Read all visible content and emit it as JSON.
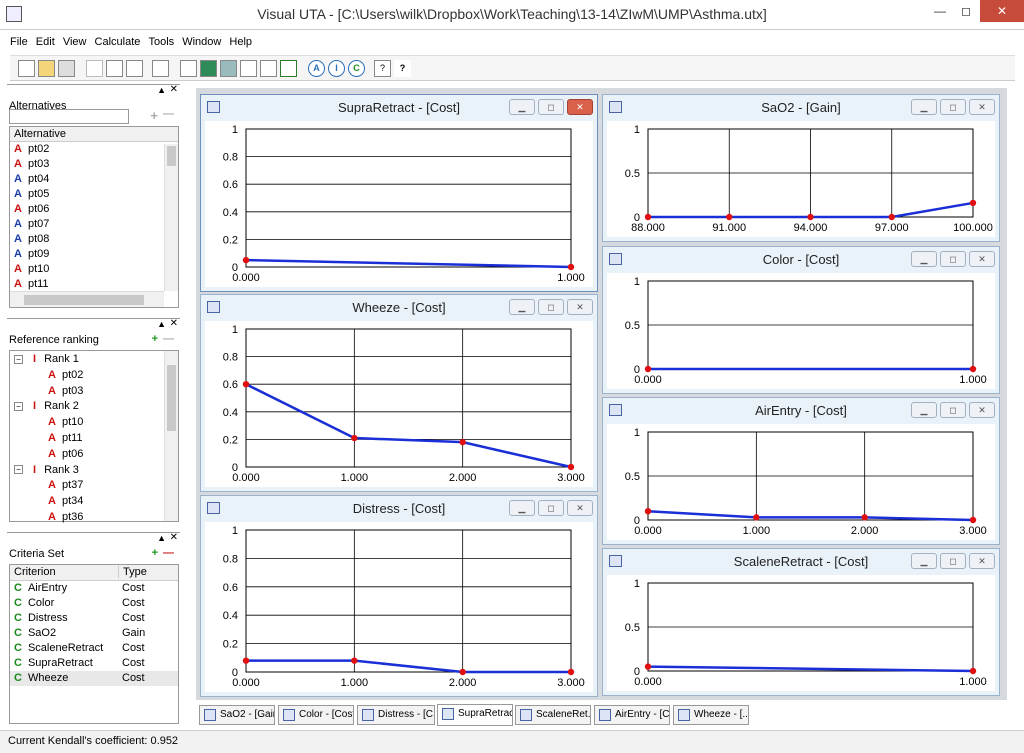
{
  "window": {
    "title": "Visual UTA - [C:\\Users\\wilk\\Dropbox\\Work\\Teaching\\13-14\\ZIwM\\UMP\\Asthma.utx]",
    "minimize": "—",
    "maximize": "◻",
    "close": "✕"
  },
  "menu": [
    "File",
    "Edit",
    "View",
    "Calculate",
    "Tools",
    "Window",
    "Help"
  ],
  "toolbar": [
    "new-icon",
    "open-icon",
    "save-icon",
    "cut-icon",
    "copy-icon",
    "paste-icon",
    "print-icon",
    "calculator-icon",
    "grid-icon",
    "table-icon",
    "chart-icon",
    "report-icon",
    "bar-chart-icon",
    "alternatives-icon",
    "info-icon",
    "criteria-icon",
    "help-icon",
    "context-help-icon"
  ],
  "toolbar_glyphs": {
    "alt": "A",
    "info": "I",
    "crit": "C",
    "help": "?",
    "ctx": "?"
  },
  "alternatives": {
    "heading": "Alternatives",
    "add": "+",
    "remove": "—",
    "column": "Alternative",
    "items": [
      {
        "letter": "A",
        "name": "pt02",
        "color": "red"
      },
      {
        "letter": "A",
        "name": "pt03",
        "color": "red"
      },
      {
        "letter": "A",
        "name": "pt04",
        "color": "blue"
      },
      {
        "letter": "A",
        "name": "pt05",
        "color": "blue"
      },
      {
        "letter": "A",
        "name": "pt06",
        "color": "red"
      },
      {
        "letter": "A",
        "name": "pt07",
        "color": "blue"
      },
      {
        "letter": "A",
        "name": "pt08",
        "color": "blue"
      },
      {
        "letter": "A",
        "name": "pt09",
        "color": "blue"
      },
      {
        "letter": "A",
        "name": "pt10",
        "color": "red"
      },
      {
        "letter": "A",
        "name": "pt11",
        "color": "red"
      }
    ]
  },
  "ranking": {
    "heading": "Reference ranking",
    "add": "+",
    "remove": "—",
    "rows": [
      {
        "type": "rank",
        "label": "Rank 1"
      },
      {
        "type": "alt",
        "label": "pt02"
      },
      {
        "type": "alt",
        "label": "pt03"
      },
      {
        "type": "rank",
        "label": "Rank 2"
      },
      {
        "type": "alt",
        "label": "pt10"
      },
      {
        "type": "alt",
        "label": "pt11"
      },
      {
        "type": "alt",
        "label": "pt06"
      },
      {
        "type": "rank",
        "label": "Rank 3"
      },
      {
        "type": "alt",
        "label": "pt37"
      },
      {
        "type": "alt",
        "label": "pt34"
      },
      {
        "type": "alt",
        "label": "pt36"
      }
    ]
  },
  "criteria": {
    "heading": "Criteria Set",
    "add": "+",
    "remove": "—",
    "col_criterion": "Criterion",
    "col_type": "Type",
    "items": [
      {
        "name": "AirEntry",
        "type": "Cost"
      },
      {
        "name": "Color",
        "type": "Cost"
      },
      {
        "name": "Distress",
        "type": "Cost"
      },
      {
        "name": "SaO2",
        "type": "Gain"
      },
      {
        "name": "ScaleneRetract",
        "type": "Cost"
      },
      {
        "name": "SupraRetract",
        "type": "Cost"
      },
      {
        "name": "Wheeze",
        "type": "Cost"
      }
    ]
  },
  "chart_data": [
    {
      "type": "line",
      "title": "SupraRetract - [Cost]",
      "x": [
        0,
        1
      ],
      "xticks": [
        "0.000",
        "1.000"
      ],
      "y": [
        0.05,
        0.0
      ],
      "ylim": [
        0,
        1
      ],
      "yticks": [
        "0",
        "0.2",
        "0.4",
        "0.6",
        "0.8",
        "1"
      ]
    },
    {
      "type": "line",
      "title": "Wheeze - [Cost]",
      "x": [
        0,
        1,
        2,
        3
      ],
      "xticks": [
        "0.000",
        "1.000",
        "2.000",
        "3.000"
      ],
      "y": [
        0.6,
        0.21,
        0.18,
        0.0
      ],
      "ylim": [
        0,
        1
      ],
      "yticks": [
        "0",
        "0.2",
        "0.4",
        "0.6",
        "0.8",
        "1"
      ]
    },
    {
      "type": "line",
      "title": "Distress - [Cost]",
      "x": [
        0,
        1,
        2,
        3
      ],
      "xticks": [
        "0.000",
        "1.000",
        "2.000",
        "3.000"
      ],
      "y": [
        0.08,
        0.08,
        0.0,
        0.0
      ],
      "ylim": [
        0,
        1
      ],
      "yticks": [
        "0",
        "0.2",
        "0.4",
        "0.6",
        "0.8",
        "1"
      ]
    },
    {
      "type": "line",
      "title": "SaO2 - [Gain]",
      "x": [
        88,
        91,
        94,
        97,
        100
      ],
      "xticks": [
        "88.000",
        "91.000",
        "94.000",
        "97.000",
        "100.000"
      ],
      "y": [
        0,
        0,
        0,
        0,
        0.16
      ],
      "ylim": [
        0,
        1
      ],
      "yticks": [
        "0",
        "0.5",
        "1"
      ]
    },
    {
      "type": "line",
      "title": "Color - [Cost]",
      "x": [
        0,
        1
      ],
      "xticks": [
        "0.000",
        "1.000"
      ],
      "y": [
        0,
        0
      ],
      "ylim": [
        0,
        1
      ],
      "yticks": [
        "0",
        "0.5",
        "1"
      ]
    },
    {
      "type": "line",
      "title": "AirEntry - [Cost]",
      "x": [
        0,
        1,
        2,
        3
      ],
      "xticks": [
        "0.000",
        "1.000",
        "2.000",
        "3.000"
      ],
      "y": [
        0.1,
        0.03,
        0.03,
        0.0
      ],
      "ylim": [
        0,
        1
      ],
      "yticks": [
        "0",
        "0.5",
        "1"
      ]
    },
    {
      "type": "line",
      "title": "ScaleneRetract - [Cost]",
      "x": [
        0,
        1
      ],
      "xticks": [
        "0.000",
        "1.000"
      ],
      "y": [
        0.05,
        0.0
      ],
      "ylim": [
        0,
        1
      ],
      "yticks": [
        "0",
        "0.5",
        "1"
      ]
    }
  ],
  "tabs": [
    "SaO2 - [Gain]",
    "Color - [Cost]",
    "Distress - [C...",
    "SupraRetrac...",
    "ScaleneRet...",
    "AirEntry - [C...",
    "Wheeze - [..."
  ],
  "status": "Current Kendall's coefficient: 0.952",
  "colors": {
    "line": "#1a2fd6",
    "point": "#e01010"
  }
}
